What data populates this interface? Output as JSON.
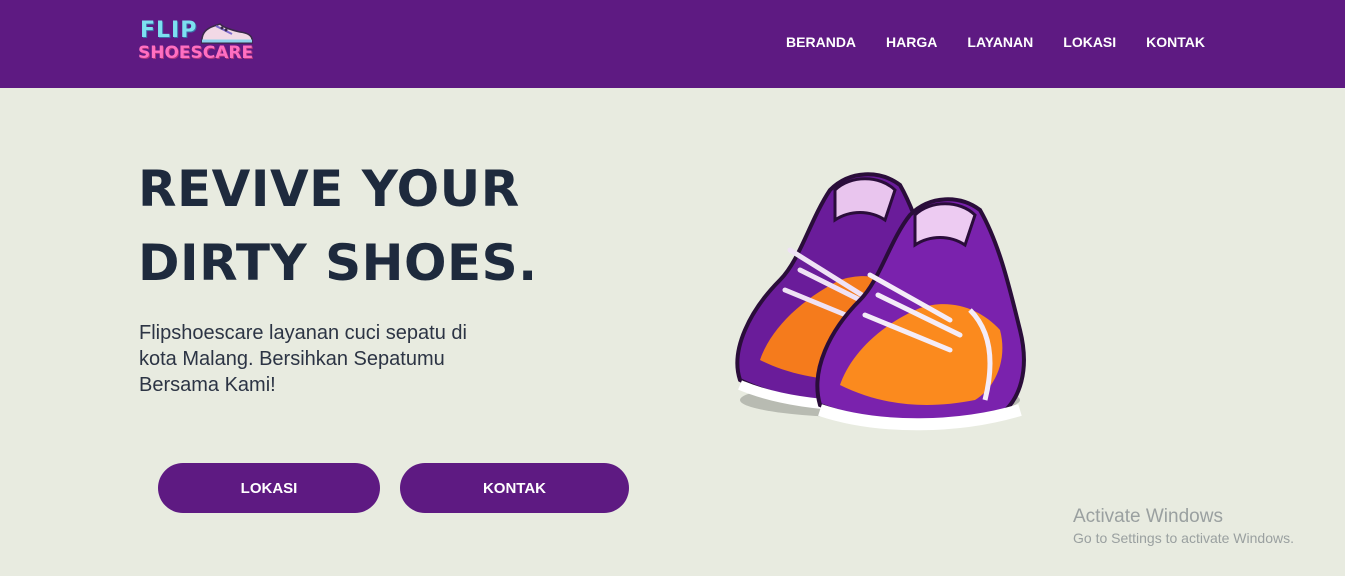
{
  "brand": {
    "line1": "FLIP",
    "line2": "SHOESCARE"
  },
  "nav": {
    "items": [
      "BERANDA",
      "HARGA",
      "LAYANAN",
      "LOKASI",
      "KONTAK"
    ]
  },
  "hero": {
    "title_line1": "REVIVE YOUR",
    "title_line2": "DIRTY SHOES.",
    "description": "Flipshoescare layanan cuci sepatu di kota Malang. Bersihkan Sepatumu Bersama Kami!",
    "button_lokasi": "LOKASI",
    "button_kontak": "KONTAK",
    "image_icon": "sneakers-illustration"
  },
  "colors": {
    "primary": "#5e1a82",
    "background": "#e8ebe0",
    "title": "#1e2a3d"
  },
  "watermark": {
    "title": "Activate Windows",
    "subtitle": "Go to Settings to activate Windows."
  }
}
